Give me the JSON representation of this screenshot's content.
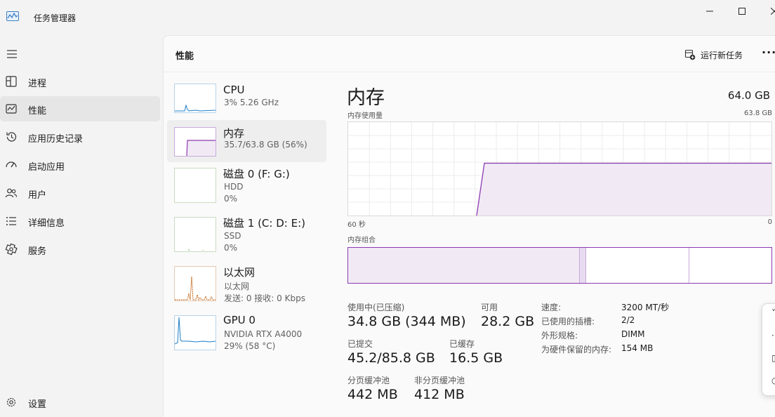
{
  "app": {
    "title": "任务管理器"
  },
  "sidebar": {
    "items": [
      {
        "label": "进程",
        "icon": "processes-icon"
      },
      {
        "label": "性能",
        "icon": "performance-icon",
        "active": true
      },
      {
        "label": "应用历史记录",
        "icon": "history-icon"
      },
      {
        "label": "启动应用",
        "icon": "startup-icon"
      },
      {
        "label": "用户",
        "icon": "users-icon"
      },
      {
        "label": "详细信息",
        "icon": "details-icon"
      },
      {
        "label": "服务",
        "icon": "services-icon"
      }
    ],
    "settings_label": "设置"
  },
  "header": {
    "title": "性能",
    "run_task_label": "运行新任务",
    "more_label": "···"
  },
  "perf_list": [
    {
      "name": "CPU",
      "line1": "3%  5.26 GHz",
      "line2": ""
    },
    {
      "name": "内存",
      "line1": "35.7/63.8 GB (56%)",
      "line2": "",
      "active": true
    },
    {
      "name": "磁盘 0 (F: G:)",
      "line1": "HDD",
      "line2": "0%"
    },
    {
      "name": "磁盘 1 (C: D: E:)",
      "line1": "SSD",
      "line2": "0%"
    },
    {
      "name": "以太网",
      "line1": "以太网",
      "line2": "发送: 0 接收: 0 Kbps"
    },
    {
      "name": "GPU 0",
      "line1": "NVIDIA RTX A4000",
      "line2": "29% (58 °C)"
    }
  ],
  "memory": {
    "title": "内存",
    "total": "64.0 GB",
    "usage_label": "内存使用量",
    "usage_max": "63.8 GB",
    "axis_left": "60 秒",
    "axis_right": "0",
    "usage_level": 0.56,
    "composition_label": "内存组合",
    "stats": {
      "in_use_label": "使用中(已压缩)",
      "in_use_value": "34.8 GB (344 MB)",
      "available_label": "可用",
      "available_value": "28.2 GB",
      "committed_label": "已提交",
      "committed_value": "45.2/85.8 GB",
      "cached_label": "已缓存",
      "cached_value": "16.5 GB",
      "paged_label": "分页缓冲池",
      "paged_value": "442 MB",
      "nonpaged_label": "非分页缓冲池",
      "nonpaged_value": "412 MB"
    },
    "details": [
      {
        "key": "速度:",
        "value": "3200 MT/秒"
      },
      {
        "key": "已使用的插槽:",
        "value": "2/2"
      },
      {
        "key": "外形规格:",
        "value": "DIMM"
      },
      {
        "key": "为硬件保留的内存:",
        "value": "154 MB"
      }
    ]
  },
  "colors": {
    "memory_accent": "#8c3ab1",
    "memory_fill": "#f1eaf5",
    "cpu_accent": "#1e7ec8",
    "ethernet_accent": "#c26112"
  }
}
